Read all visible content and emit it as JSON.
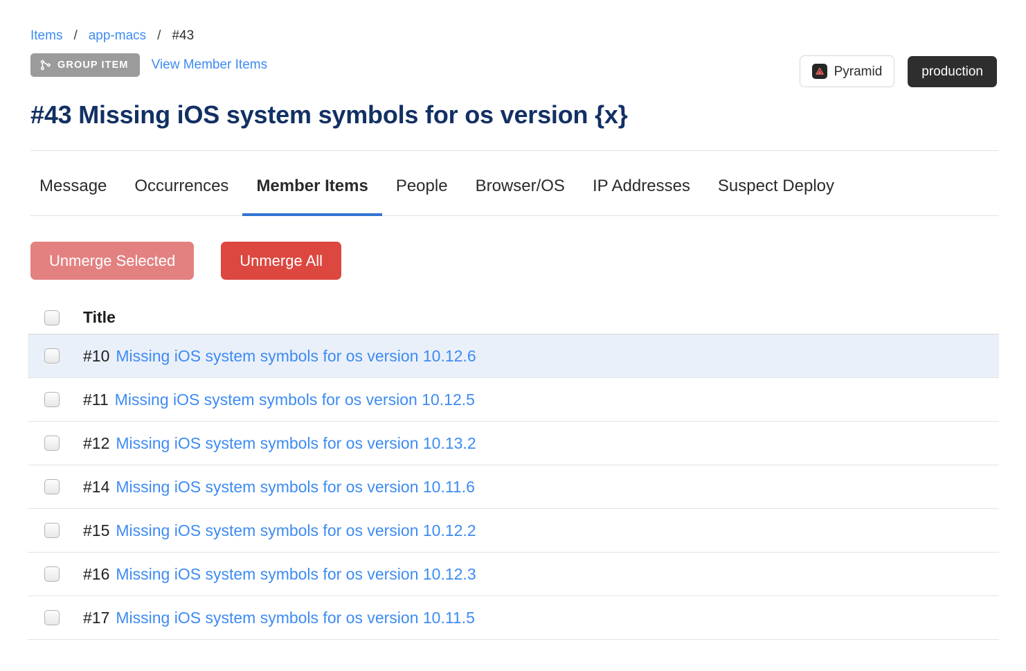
{
  "breadcrumb": {
    "items": [
      {
        "label": "Items",
        "link": true
      },
      {
        "label": "app-macs",
        "link": true
      },
      {
        "label": "#43",
        "link": false
      }
    ],
    "separator": "/"
  },
  "badges": {
    "group_item_label": "GROUP ITEM",
    "group_item_icon": "code-branch-icon",
    "view_member_items_label": "View Member Items"
  },
  "top_right": {
    "project": {
      "label": "Pyramid",
      "icon": "pyramid-app-icon"
    },
    "environment": {
      "label": "production"
    }
  },
  "header": {
    "title": "#43 Missing iOS system symbols for os version {x}"
  },
  "tabs": {
    "active": "Member Items",
    "items": [
      {
        "label": "Message"
      },
      {
        "label": "Occurrences"
      },
      {
        "label": "Member Items"
      },
      {
        "label": "People"
      },
      {
        "label": "Browser/OS"
      },
      {
        "label": "IP Addresses"
      },
      {
        "label": "Suspect Deploy"
      }
    ]
  },
  "actions": {
    "unmerge_selected_label": "Unmerge Selected",
    "unmerge_all_label": "Unmerge All"
  },
  "table": {
    "select_all_checked": false,
    "columns": {
      "title": "Title"
    },
    "rows": [
      {
        "id": "#10",
        "title": "Missing iOS system symbols for os version 10.12.6",
        "checked": false,
        "highlighted": true
      },
      {
        "id": "#11",
        "title": "Missing iOS system symbols for os version 10.12.5",
        "checked": false,
        "highlighted": false
      },
      {
        "id": "#12",
        "title": "Missing iOS system symbols for os version 10.13.2",
        "checked": false,
        "highlighted": false
      },
      {
        "id": "#14",
        "title": "Missing iOS system symbols for os version 10.11.6",
        "checked": false,
        "highlighted": false
      },
      {
        "id": "#15",
        "title": "Missing iOS system symbols for os version 10.12.2",
        "checked": false,
        "highlighted": false
      },
      {
        "id": "#16",
        "title": "Missing iOS system symbols for os version 10.12.3",
        "checked": false,
        "highlighted": false
      },
      {
        "id": "#17",
        "title": "Missing iOS system symbols for os version 10.11.5",
        "checked": false,
        "highlighted": false
      }
    ]
  },
  "colors": {
    "link": "#3d8bf2",
    "title": "#123063",
    "tab_active_underline": "#3174d0",
    "btn_muted": "#e38181",
    "btn_danger": "#dc4740",
    "badge_gray": "#9b9b9b",
    "env_dark": "#2e2e2e",
    "row_highlight": "#eaf0fa",
    "accent_triangle": "#f0675c"
  }
}
